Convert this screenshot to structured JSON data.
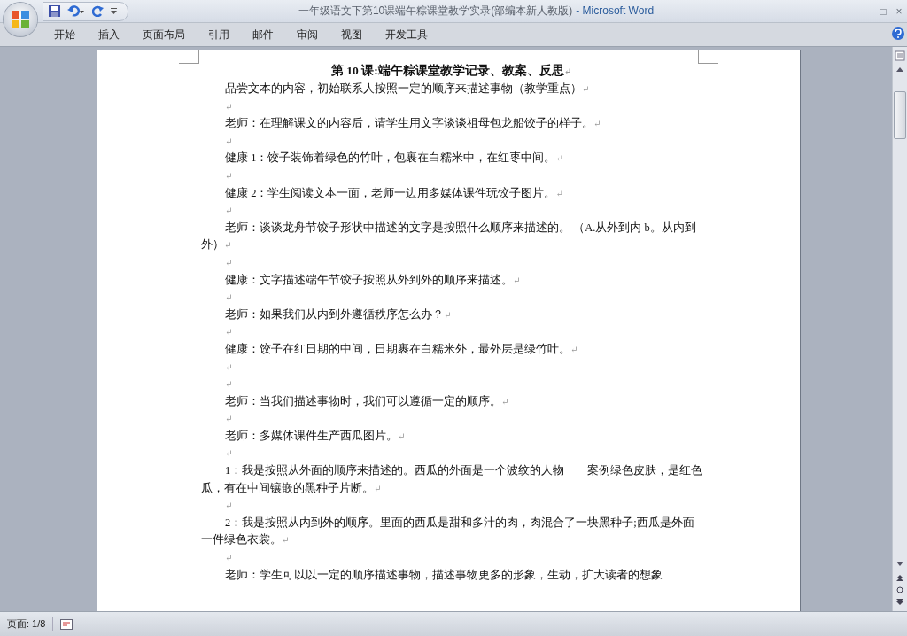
{
  "window": {
    "title": "一年级语文下第10课端午粽课堂教学实录(部编本新人教版)",
    "app": "- Microsoft Word",
    "controls": [
      "–",
      "□",
      "×"
    ]
  },
  "ribbon": {
    "tabs": [
      {
        "label": "开始"
      },
      {
        "label": "插入"
      },
      {
        "label": "页面布局"
      },
      {
        "label": "引用"
      },
      {
        "label": "邮件"
      },
      {
        "label": "审阅"
      },
      {
        "label": "视图"
      },
      {
        "label": "开发工具"
      }
    ]
  },
  "document": {
    "title": "第 10 课:端午粽课堂教学记录、教案、反思",
    "title_end": "↵",
    "paragraphs": [
      {
        "text": "品尝文本的内容，初始联系人按照一定的顺序来描述事物（教学重点）",
        "end": "↵"
      },
      {
        "end": "↵"
      },
      {
        "text": "老师：在理解课文的内容后，请学生用文字谈谈祖母包龙船饺子的样子。",
        "end": "↵"
      },
      {
        "end": "↵"
      },
      {
        "text": "健康 1：饺子装饰着绿色的竹叶，包裹在白糯米中，在红枣中间。",
        "end": "↵"
      },
      {
        "end": "↵"
      },
      {
        "text": "健康 2：学生阅读文本一面，老师一边用多媒体课件玩饺子图片。",
        "end": "↵"
      },
      {
        "end": "↵"
      },
      {
        "text": "老师：谈谈龙舟节饺子形状中描述的文字是按照什么顺序来描述的。 （A.从外到内 b。从内到外）",
        "end": "↵"
      },
      {
        "end": "↵"
      },
      {
        "text": "健康：文字描述端午节饺子按照从外到外的顺序来描述。",
        "end": "↵"
      },
      {
        "end": "↵"
      },
      {
        "text": "老师：如果我们从内到外遵循秩序怎么办？",
        "end": "↵"
      },
      {
        "end": "↵"
      },
      {
        "text": "健康：饺子在红日期的中间，日期裹在白糯米外，最外层是绿竹叶。",
        "end": "↵"
      },
      {
        "end": "↵"
      },
      {
        "end": "↵"
      },
      {
        "text": "老师：当我们描述事物时，我们可以遵循一定的顺序。",
        "end": "↵"
      },
      {
        "end": "↵"
      },
      {
        "text": "老师：多媒体课件生产西瓜图片。",
        "end": "↵"
      },
      {
        "end": "↵"
      },
      {
        "text": "1：我是按照从外面的顺序来描述的。西瓜的外面是一个波纹的人物　　案例绿色皮肤，是红色瓜，有在中间镶嵌的黑种子片断。",
        "end": "↵"
      },
      {
        "end": "↵"
      },
      {
        "text": "2：我是按照从内到外的顺序。里面的西瓜是甜和多汁的肉，肉混合了一块黑种子;西瓜是外面一件绿色衣裳。",
        "end": "↵"
      },
      {
        "end": "↵"
      },
      {
        "text": "老师：学生可以以一定的顺序描述事物，描述事物更多的形象，生动，扩大读者的想象"
      }
    ]
  },
  "status_bar": {
    "page": "页面: 1/8"
  }
}
